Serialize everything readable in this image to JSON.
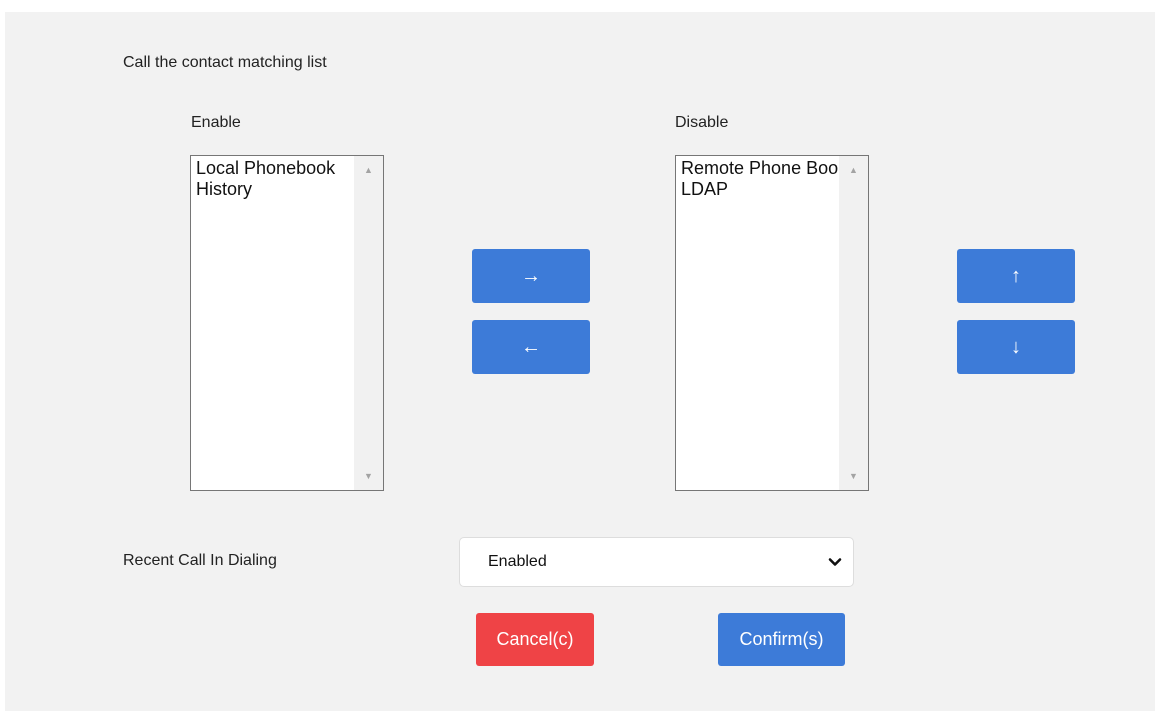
{
  "title": "Call the contact matching list",
  "enable": {
    "label": "Enable",
    "items": [
      "Local Phonebook",
      "History"
    ]
  },
  "disable": {
    "label": "Disable",
    "items": [
      "Remote Phone Book",
      "LDAP"
    ]
  },
  "buttons": {
    "move_right": "→",
    "move_left": "←",
    "move_up": "↑",
    "move_down": "↓",
    "cancel": "Cancel(c)",
    "confirm": "Confirm(s)"
  },
  "recent_call": {
    "label": "Recent Call In Dialing",
    "value": "Enabled"
  },
  "colors": {
    "panel_bg": "#f2f2f2",
    "primary": "#3d7bd8",
    "danger": "#ef4346"
  }
}
